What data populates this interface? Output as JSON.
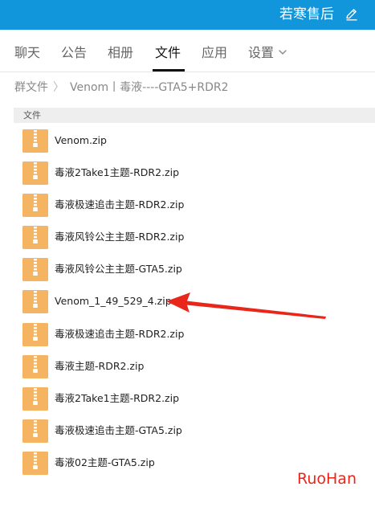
{
  "header": {
    "group_name": "若寒售后",
    "edit_icon": "edit-icon"
  },
  "tabs": [
    {
      "label": "聊天"
    },
    {
      "label": "公告"
    },
    {
      "label": "相册"
    },
    {
      "label": "文件",
      "active": true
    },
    {
      "label": "应用"
    },
    {
      "label": "设置",
      "icon": "chevron-down-icon"
    }
  ],
  "breadcrumb": {
    "root": "群文件",
    "separator": "〉",
    "current": "Venom丨毒液----GTA5+RDR2"
  },
  "file_list": {
    "column_header": "文件",
    "files": [
      {
        "name": "Venom.zip",
        "icon": "zip-file-icon"
      },
      {
        "name": "毒液2Take1主题-RDR2.zip",
        "icon": "zip-file-icon"
      },
      {
        "name": "毒液极速追击主题-RDR2.zip",
        "icon": "zip-file-icon"
      },
      {
        "name": "毒液风铃公主主题-RDR2.zip",
        "icon": "zip-file-icon"
      },
      {
        "name": "毒液风铃公主主题-GTA5.zip",
        "icon": "zip-file-icon"
      },
      {
        "name": "Venom_1_49_529_4.zip",
        "icon": "zip-file-icon"
      },
      {
        "name": "毒液极速追击主题-RDR2.zip",
        "icon": "zip-file-icon"
      },
      {
        "name": "毒液主题-RDR2.zip",
        "icon": "zip-file-icon"
      },
      {
        "name": "毒液2Take1主题-RDR2.zip",
        "icon": "zip-file-icon"
      },
      {
        "name": "毒液极速追击主题-GTA5.zip",
        "icon": "zip-file-icon"
      },
      {
        "name": "毒液02主题-GTA5.zip",
        "icon": "zip-file-icon"
      }
    ]
  },
  "annotation": {
    "arrow_color": "#e8261a",
    "pointing_to": "Venom_1_49_529_4.zip"
  },
  "watermark": "RuoHan",
  "colors": {
    "titlebar": "#1296db",
    "zip_icon": "#f5b462",
    "accent_red": "#e8261a"
  }
}
